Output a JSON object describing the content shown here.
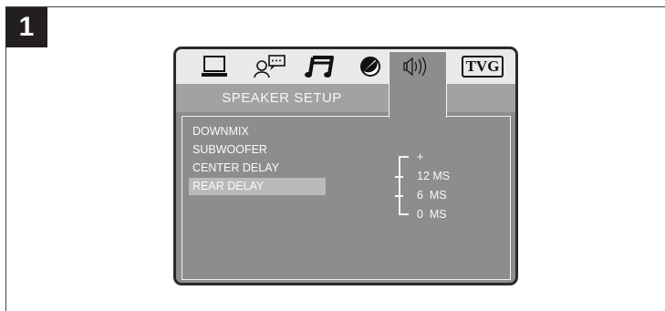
{
  "step": {
    "number": "1"
  },
  "osd": {
    "title": "SPEAKER  SETUP",
    "tabs": [
      {
        "icon": "monitor-icon"
      },
      {
        "icon": "language-icon"
      },
      {
        "icon": "audio-note-icon"
      },
      {
        "icon": "picture-icon"
      },
      {
        "icon": "speaker-icon",
        "active": true
      },
      {
        "icon": "tvg-icon",
        "label": "TVG"
      }
    ],
    "menu": [
      {
        "label": "DOWNMIX"
      },
      {
        "label": "SUBWOOFER"
      },
      {
        "label": "CENTER DELAY"
      },
      {
        "label": "REAR DELAY",
        "selected": true
      }
    ],
    "options": [
      {
        "label": "+"
      },
      {
        "label": "12 MS"
      },
      {
        "label": "6  MS"
      },
      {
        "label": "0  MS"
      }
    ],
    "colors": {
      "screen": "#8d8d8d",
      "icon_bar": "#e9e9e9",
      "title_bar": "#a2a2a2",
      "selection": "#b9b9b9",
      "bezel": "#2a2a2a",
      "text": "#fafafa"
    }
  }
}
